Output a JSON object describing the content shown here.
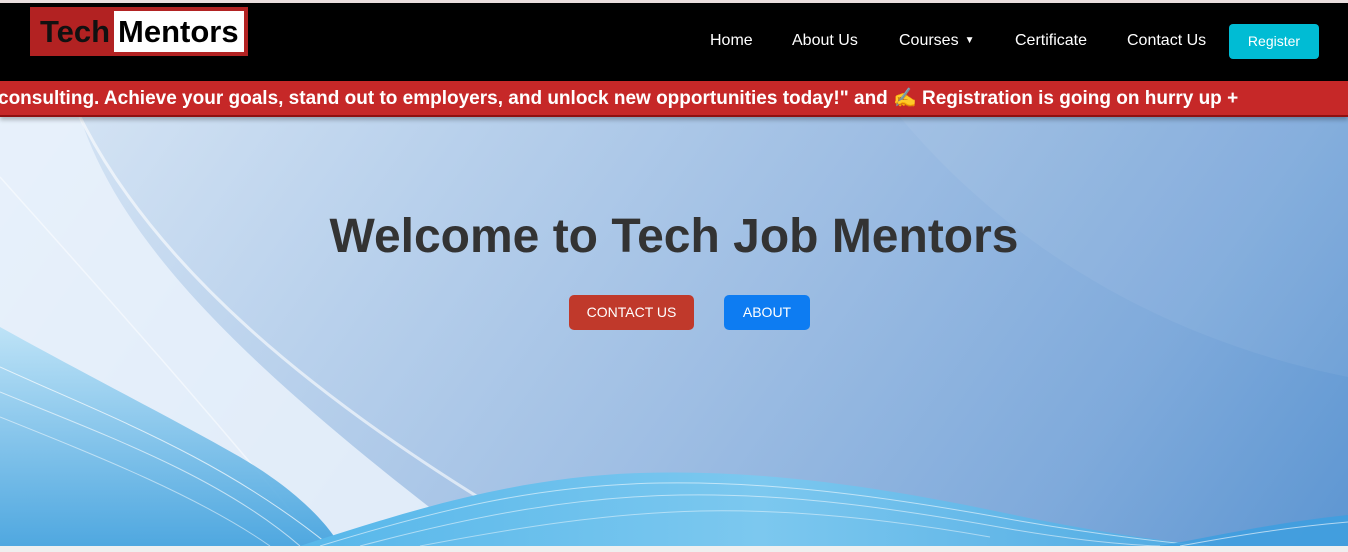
{
  "header": {
    "logo_part1": "Tech",
    "logo_part2": "Mentors",
    "nav": {
      "home": "Home",
      "about": "About Us",
      "courses": "Courses",
      "certificate": "Certificate",
      "contact": "Contact Us"
    },
    "courses_caret": "▼",
    "register_label": "Register"
  },
  "ticker": {
    "text": "consulting. Achieve your goals, stand out to employers, and unlock new opportunities today!\" and ✍️ Registration is going on hurry up +"
  },
  "hero": {
    "title": "Welcome to Tech Job Mentors",
    "contact_button": "CONTACT US",
    "about_button": "ABOUT"
  },
  "colors": {
    "navbar_bg": "#000000",
    "brand_red": "#c62828",
    "register_bg": "#00bcd4",
    "contact_btn_bg": "#c0392b",
    "about_btn_bg": "#0d7cf2"
  }
}
